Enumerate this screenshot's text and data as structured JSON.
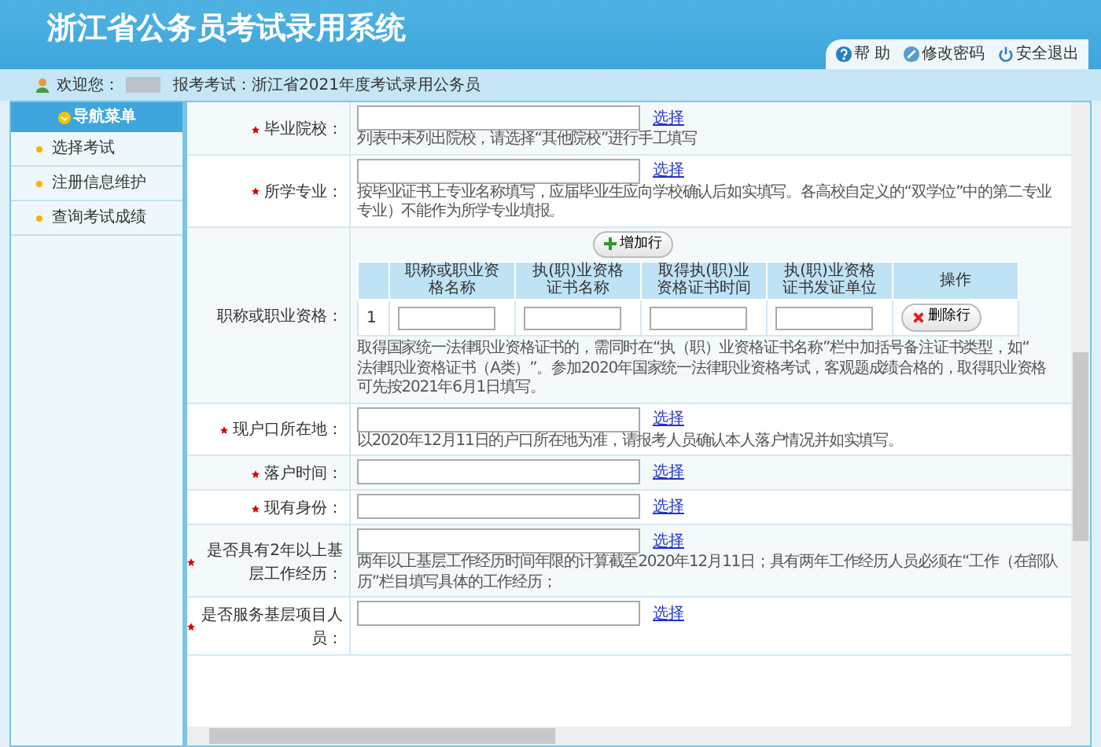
{
  "header": {
    "title": "浙江省公务员考试录用系统",
    "links": [
      {
        "kind": "help",
        "label": "帮 助"
      },
      {
        "kind": "password",
        "label": "修改密码"
      },
      {
        "kind": "logout",
        "label": "安全退出"
      }
    ]
  },
  "info_bar": {
    "welcome": "欢迎您：",
    "exam": "报考考试：浙江省2021年度考试录用公务员"
  },
  "sidebar": {
    "title": "导航菜单",
    "items": [
      {
        "label": "选择考试"
      },
      {
        "label": "注册信息维护"
      },
      {
        "label": "查询考试成绩"
      }
    ]
  },
  "form": {
    "rows": [
      {
        "kind": "field",
        "label": "毕业院校：",
        "required": true,
        "link": "选择",
        "hint_lines": [
          "列表中未列出院校，请选择“其他院校”进行手工填写"
        ]
      },
      {
        "kind": "field",
        "label": "所学专业：",
        "required": true,
        "link": "选择",
        "hint_lines": [
          "按毕业证书上专业名称填写，应届毕业生应向学校确认后如实填写。各高校自定义的“双学位”中的第二专业",
          "专业）不能作为所学专业填报。"
        ]
      },
      {
        "kind": "table",
        "label": "职称或职业资格：",
        "required": false,
        "add_button": "增加行",
        "columns": [
          "职称或职业资格名称",
          "执(职)业资格证书名称",
          "取得执(职)业资格证书时间",
          "执(职)业资格证书发证单位",
          "操作"
        ],
        "rows": [
          {
            "index": "1",
            "action": "删除行"
          }
        ],
        "hint_lines": [
          "取得国家统一法律职业资格证书的，需同时在“执（职）业资格证书名称”栏中加括号备注证书类型，如“",
          "法律职业资格证书（A类）”。参加2020年国家统一法律职业资格考试，客观题成绩合格的，取得职业资格",
          "可先按2021年6月1日填写。"
        ]
      },
      {
        "kind": "field",
        "label": "现户口所在地：",
        "required": true,
        "link": "选择",
        "hint_lines": [
          "以2020年12月11日的户口所在地为准，请报考人员确认本人落户情况并如实填写。"
        ]
      },
      {
        "kind": "field",
        "label": "落户时间：",
        "required": true,
        "link": "选择",
        "hint_lines": []
      },
      {
        "kind": "field",
        "label": "现有身份：",
        "required": true,
        "link": "选择",
        "hint_lines": []
      },
      {
        "kind": "field",
        "label": "是否具有2年以上基层工作经历：",
        "required": true,
        "link": "选择",
        "hint_lines": [
          "两年以上基层工作经历时间年限的计算截至2020年12月11日；具有两年工作经历人员必须在“工作（在部队",
          "历”栏目填写具体的工作经历；"
        ]
      },
      {
        "kind": "field",
        "label": "是否服务基层项目人员：",
        "required": true,
        "link": "选择",
        "hint_lines": []
      }
    ]
  }
}
